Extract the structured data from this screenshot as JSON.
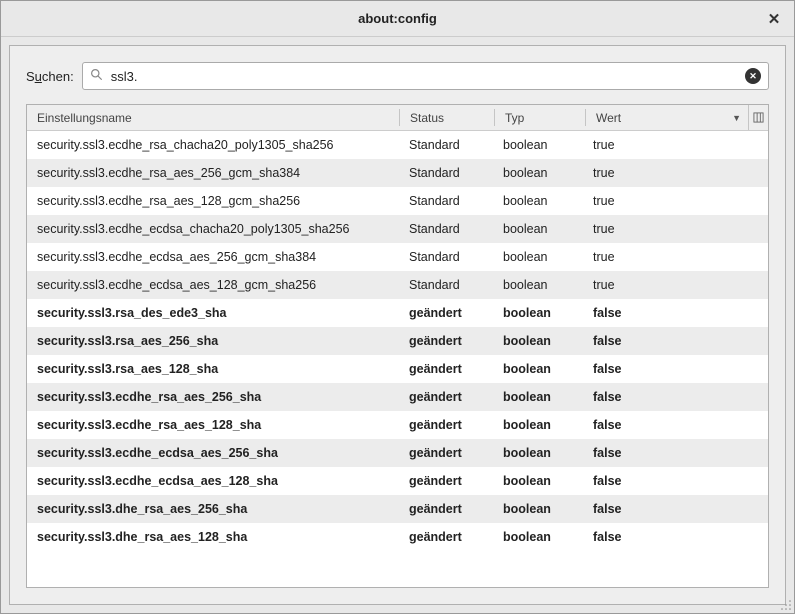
{
  "window": {
    "title": "about:config"
  },
  "search": {
    "label_pre": "S",
    "label_underline": "u",
    "label_post": "chen:",
    "value": "ssl3."
  },
  "columns": {
    "name": "Einstellungsname",
    "status": "Status",
    "type": "Typ",
    "value": "Wert"
  },
  "rows": [
    {
      "name": "security.ssl3.ecdhe_rsa_chacha20_poly1305_sha256",
      "status": "Standard",
      "type": "boolean",
      "value": "true",
      "modified": false
    },
    {
      "name": "security.ssl3.ecdhe_rsa_aes_256_gcm_sha384",
      "status": "Standard",
      "type": "boolean",
      "value": "true",
      "modified": false
    },
    {
      "name": "security.ssl3.ecdhe_rsa_aes_128_gcm_sha256",
      "status": "Standard",
      "type": "boolean",
      "value": "true",
      "modified": false
    },
    {
      "name": "security.ssl3.ecdhe_ecdsa_chacha20_poly1305_sha256",
      "status": "Standard",
      "type": "boolean",
      "value": "true",
      "modified": false
    },
    {
      "name": "security.ssl3.ecdhe_ecdsa_aes_256_gcm_sha384",
      "status": "Standard",
      "type": "boolean",
      "value": "true",
      "modified": false
    },
    {
      "name": "security.ssl3.ecdhe_ecdsa_aes_128_gcm_sha256",
      "status": "Standard",
      "type": "boolean",
      "value": "true",
      "modified": false
    },
    {
      "name": "security.ssl3.rsa_des_ede3_sha",
      "status": "geändert",
      "type": "boolean",
      "value": "false",
      "modified": true
    },
    {
      "name": "security.ssl3.rsa_aes_256_sha",
      "status": "geändert",
      "type": "boolean",
      "value": "false",
      "modified": true
    },
    {
      "name": "security.ssl3.rsa_aes_128_sha",
      "status": "geändert",
      "type": "boolean",
      "value": "false",
      "modified": true
    },
    {
      "name": "security.ssl3.ecdhe_rsa_aes_256_sha",
      "status": "geändert",
      "type": "boolean",
      "value": "false",
      "modified": true
    },
    {
      "name": "security.ssl3.ecdhe_rsa_aes_128_sha",
      "status": "geändert",
      "type": "boolean",
      "value": "false",
      "modified": true
    },
    {
      "name": "security.ssl3.ecdhe_ecdsa_aes_256_sha",
      "status": "geändert",
      "type": "boolean",
      "value": "false",
      "modified": true
    },
    {
      "name": "security.ssl3.ecdhe_ecdsa_aes_128_sha",
      "status": "geändert",
      "type": "boolean",
      "value": "false",
      "modified": true
    },
    {
      "name": "security.ssl3.dhe_rsa_aes_256_sha",
      "status": "geändert",
      "type": "boolean",
      "value": "false",
      "modified": true
    },
    {
      "name": "security.ssl3.dhe_rsa_aes_128_sha",
      "status": "geändert",
      "type": "boolean",
      "value": "false",
      "modified": true
    }
  ]
}
